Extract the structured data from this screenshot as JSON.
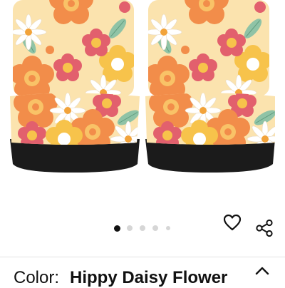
{
  "gallery": {
    "image_alt": "Two floral car seat covers",
    "dot_count": 5,
    "active_index": 0
  },
  "actions": {
    "wishlist_icon": "heart-outline-icon",
    "share_icon": "share-icon"
  },
  "variant": {
    "label": "Color:",
    "value": "Hippy Daisy Flower",
    "expand_icon": "chevron-up-icon"
  },
  "colors": {
    "background_cream": "#fbe3ae",
    "orange": "#f28d4a",
    "pink": "#e2606d",
    "yellow": "#f7c34b",
    "green": "#8fc3a6",
    "base_black": "#1b1b1b"
  }
}
